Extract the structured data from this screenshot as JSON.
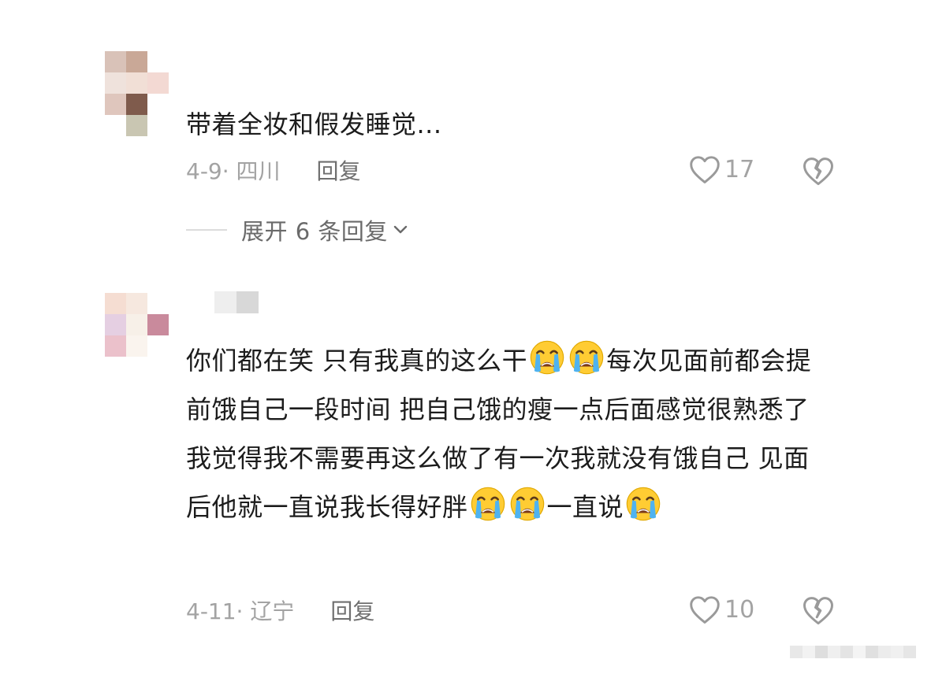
{
  "comments": [
    {
      "avatar_colors": [
        "#d9c2b8",
        "#c9a897",
        "#ffffff",
        "#efe2dc",
        "#f1dfd6",
        "#f3d9d3",
        "#dfc6bd",
        "#7f5b4c",
        "#ffffff",
        "#ffffff",
        "#c9c6b2",
        "#ffffff"
      ],
      "text": "带着全妆和假发睡觉...",
      "date_location": "4-9· 四川",
      "reply_label": "回复",
      "likes": "17",
      "expand_label": "展开 6 条回复"
    },
    {
      "avatar_colors": [
        "#f5ddd2",
        "#f6e8df",
        "#ffffff",
        "#e5cfe2",
        "#f7f0e8",
        "#c98a9c",
        "#ebc1cb",
        "#faf4ee",
        "#ffffff"
      ],
      "username_colors": [
        "#eeeeee",
        "#d8d8d8"
      ],
      "text_parts": [
        "你们都在笑 只有我真的这么干",
        "每次见面前都会提前饿自己一段时间 把自己饿的瘦一点后面感觉很熟悉了我觉得我不需要再这么做了有一次我就没有饿自己 见面后他就一直说我长得好胖",
        "一直说"
      ],
      "emoji": "loudly-crying-face",
      "date_location": "4-11· 辽宁",
      "reply_label": "回复",
      "likes": "10"
    }
  ],
  "colors": {
    "text": "#1c1c1c",
    "meta": "#a3a3a3",
    "reply": "#6f6f6f",
    "expand": "#6a6a6a"
  },
  "icons": {
    "like": "heart-outline-icon",
    "dislike": "broken-heart-icon",
    "expand": "chevron-down-icon"
  }
}
